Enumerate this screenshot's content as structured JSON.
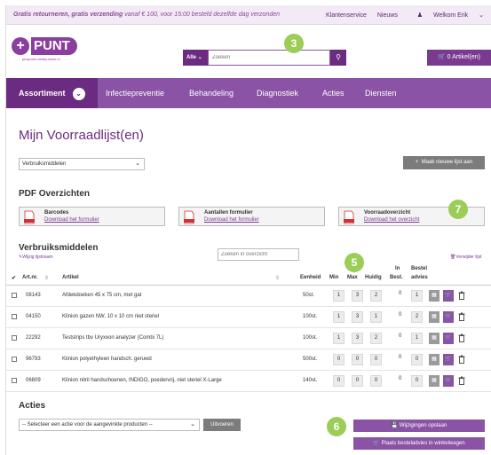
{
  "topbar": {
    "promo_bold": "Gratis retourneren, gratis verzending",
    "promo_rest": "vanaf € 100, voor 15:00 besteld dezelfde dag verzonden",
    "links": [
      "Klantenservice",
      "Nieuws",
      "Welkom Erik"
    ]
  },
  "header": {
    "logo_text": "PUNT",
    "logo_sub": "pluspunt-medipunsen.nl",
    "search_category": "Alle",
    "search_placeholder": "Zoeken",
    "cart_label": "0 Artikel(en)"
  },
  "nav": [
    "Assortiment",
    "Infectiepreventie",
    "Behandeling",
    "Diagnostiek",
    "Acties",
    "Diensten"
  ],
  "page": {
    "title": "Mijn Voorraadlijst(en)",
    "list_select": "Verbruiksmiddelen",
    "new_list_button": "Maak nieuwe lijst aan"
  },
  "pdf": {
    "title": "PDF Overzichten",
    "items": [
      {
        "title": "Barcodes",
        "link": "Download het formulier"
      },
      {
        "title": "Aantallen formulier",
        "link": "Download het formulier"
      },
      {
        "title": "Voorraadoverzicht",
        "link": "Download het overzicht"
      }
    ]
  },
  "list": {
    "title": "Verbruiksmiddelen",
    "edit_name": "Wijzig lijstnaam",
    "search_placeholder": "Zoeken in overzicht",
    "delete_list": "Verwijder lijst",
    "columns": {
      "artnr": "Art.nr.",
      "artikel": "Artikel",
      "eenheid": "Eenheid",
      "min": "Min",
      "max": "Max",
      "huidig": "Huidig",
      "in_best_1": "In",
      "in_best_2": "Best.",
      "bestel_1": "Bestel",
      "bestel_2": "advies"
    },
    "rows": [
      {
        "artnr": "08143",
        "artikel": "Afdekdoeken 45 x 75 cm, met gat",
        "eenheid": "50st.",
        "min": "1",
        "max": "3",
        "huidig": "2",
        "in_best": "0",
        "advies": "1"
      },
      {
        "artnr": "04150",
        "artikel": "Klinion gazen NW, 10 x 10 cm niet steriel",
        "eenheid": "100st.",
        "min": "1",
        "max": "3",
        "huidig": "1",
        "in_best": "0",
        "advies": "2"
      },
      {
        "artnr": "22292",
        "artikel": "Teststrips tbv Uryxxon analyzer (Combi 7L)",
        "eenheid": "100st.",
        "min": "1",
        "max": "3",
        "huidig": "2",
        "in_best": "0",
        "advies": "1"
      },
      {
        "artnr": "96793",
        "artikel": "Klinion polyethyleen handsch. geruwd",
        "eenheid": "500st.",
        "min": "0",
        "max": "0",
        "huidig": "0",
        "in_best": "0",
        "advies": "0"
      },
      {
        "artnr": "06809",
        "artikel": "Klinion nitril handschoenen, INDIGO, poedervrij, niet steriel X-Large",
        "eenheid": "140st.",
        "min": "0",
        "max": "0",
        "huidig": "0",
        "in_best": "0",
        "advies": "0"
      }
    ]
  },
  "acties": {
    "title": "Acties",
    "select_placeholder": "-- Selecteer een actie voor de aangevinkte producten --",
    "execute_button": "Uitvoeren",
    "save_button": "Wijzigingen opslaan",
    "order_button": "Plaats besteladvies in winkelwagen"
  },
  "markers": [
    "3",
    "7",
    "5",
    "6"
  ],
  "colors": {
    "brand": "#8a53a5",
    "brand_dark": "#6b2b80",
    "marker": "#9bcd57"
  }
}
